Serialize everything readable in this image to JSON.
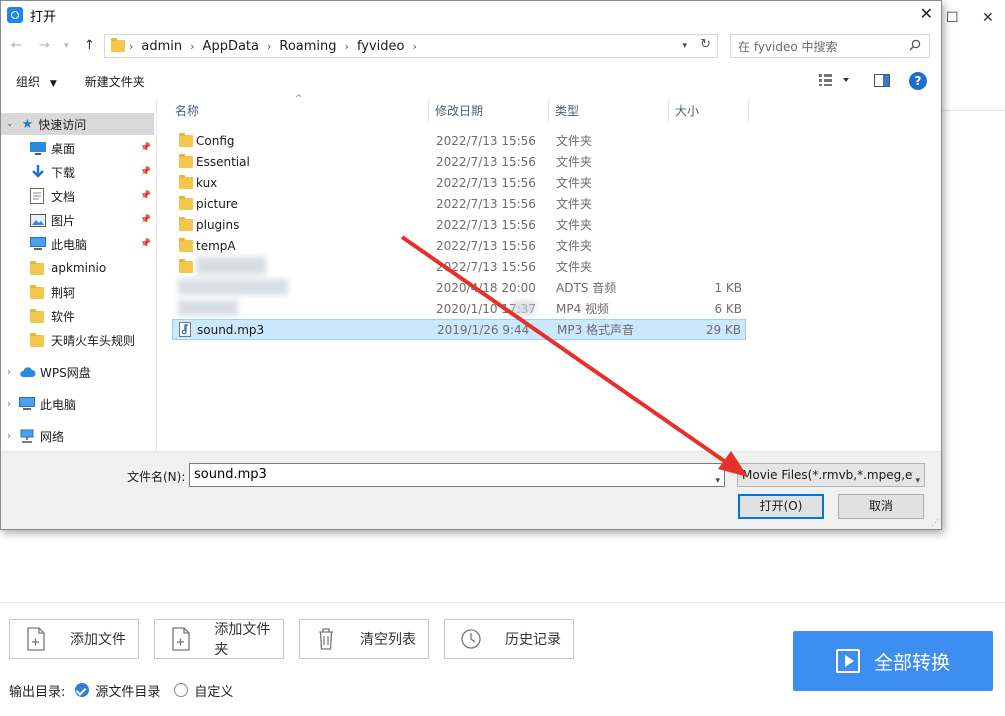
{
  "background_app": {
    "buttons": [
      {
        "label": "添加文件",
        "icon": "add-file-icon"
      },
      {
        "label": "添加文件夹",
        "icon": "add-folder-icon"
      },
      {
        "label": "清空列表",
        "icon": "trash-icon"
      },
      {
        "label": "历史记录",
        "icon": "clock-icon"
      }
    ],
    "convert_all": "全部转换",
    "output_label": "输出目录:",
    "output_options": [
      {
        "label": "源文件目录",
        "checked": true
      },
      {
        "label": "自定义",
        "checked": false
      }
    ]
  },
  "dialog": {
    "title": "打开",
    "breadcrumb": [
      "admin",
      "AppData",
      "Roaming",
      "fyvideo"
    ],
    "search_placeholder": "在 fyvideo 中搜索",
    "toolbar": {
      "organize": "组织",
      "new_folder": "新建文件夹"
    },
    "nav": {
      "quick_access": "快速访问",
      "quick_items": [
        {
          "label": "桌面",
          "icon": "desktop-icon",
          "pinned": true
        },
        {
          "label": "下载",
          "icon": "download-icon",
          "pinned": true
        },
        {
          "label": "文档",
          "icon": "document-icon",
          "pinned": true
        },
        {
          "label": "图片",
          "icon": "picture-icon",
          "pinned": true
        },
        {
          "label": "此电脑",
          "icon": "computer-icon",
          "pinned": true
        },
        {
          "label": "apkminio",
          "icon": "folder-icon",
          "pinned": false
        },
        {
          "label": "荆轲",
          "icon": "folder-icon",
          "pinned": false
        },
        {
          "label": "软件",
          "icon": "folder-icon",
          "pinned": false
        },
        {
          "label": "天晴火车头规则",
          "icon": "folder-icon",
          "pinned": false
        }
      ],
      "roots": [
        {
          "label": "WPS网盘",
          "icon": "cloud-icon"
        },
        {
          "label": "此电脑",
          "icon": "computer-icon"
        },
        {
          "label": "网络",
          "icon": "network-icon"
        }
      ]
    },
    "columns": [
      "名称",
      "修改日期",
      "类型",
      "大小"
    ],
    "files": [
      {
        "name": "Config",
        "date": "2022/7/13 15:56",
        "type": "文件夹",
        "size": ""
      },
      {
        "name": "Essential",
        "date": "2022/7/13 15:56",
        "type": "文件夹",
        "size": ""
      },
      {
        "name": "kux",
        "date": "2022/7/13 15:56",
        "type": "文件夹",
        "size": ""
      },
      {
        "name": "picture",
        "date": "2022/7/13 15:56",
        "type": "文件夹",
        "size": ""
      },
      {
        "name": "plugins",
        "date": "2022/7/13 15:56",
        "type": "文件夹",
        "size": ""
      },
      {
        "name": "tempA",
        "date": "2022/7/13 15:56",
        "type": "文件夹",
        "size": ""
      },
      {
        "name": "",
        "date": "2022/7/13 15:56",
        "type": "文件夹",
        "size": ""
      },
      {
        "name": "",
        "date": "2020/4/18 20:00",
        "type": "ADTS 音频",
        "size": "1 KB"
      },
      {
        "name": "",
        "date": "2020/1/10 17:37",
        "type": "MP4 视频",
        "size": "6 KB"
      },
      {
        "name": "sound.mp3",
        "date": "2019/1/26 9:44",
        "type": "MP3 格式声音",
        "size": "29 KB",
        "selected": true
      }
    ],
    "filename_label": "文件名(N):",
    "filename_value": "sound.mp3",
    "filetype_value": "Movie Files(*.rmvb,*.mpeg,et",
    "open_button": "打开(O)",
    "cancel_button": "取消"
  },
  "colors": {
    "accent": "#3d8ef0",
    "selection": "#cce8ff",
    "arrow": "#e8302a"
  }
}
